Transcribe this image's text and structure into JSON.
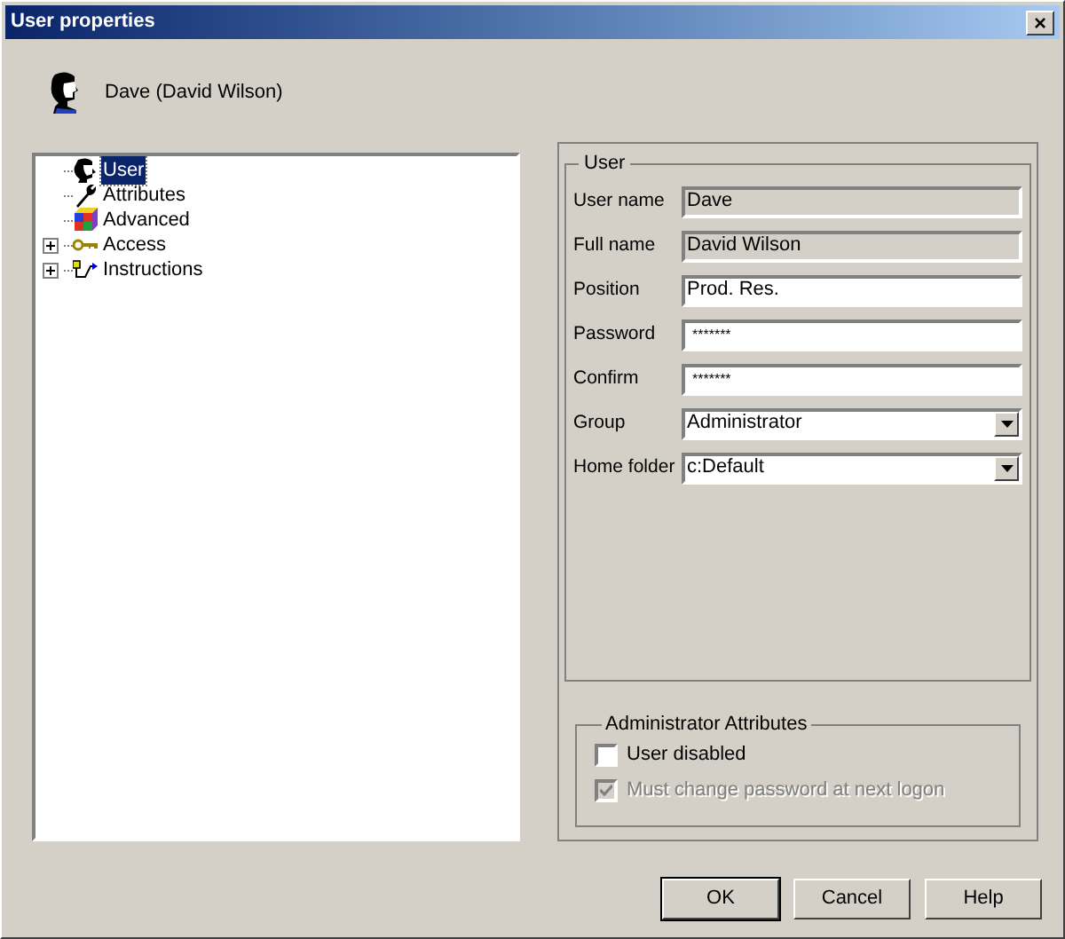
{
  "window": {
    "title": "User properties",
    "close": "×"
  },
  "header": {
    "title": "Dave (David Wilson)"
  },
  "tree": {
    "items": [
      {
        "label": "User",
        "kind": "leaf",
        "selected": true
      },
      {
        "label": "Attributes",
        "kind": "leaf",
        "selected": false
      },
      {
        "label": "Advanced",
        "kind": "leaf",
        "selected": false
      },
      {
        "label": "Access",
        "kind": "folder",
        "selected": false
      },
      {
        "label": "Instructions",
        "kind": "folder",
        "selected": false
      }
    ]
  },
  "user_group": {
    "title": "User",
    "fields": [
      {
        "label": "User name",
        "value": "Dave",
        "kind": "readonly"
      },
      {
        "label": "Full name",
        "value": "David Wilson",
        "kind": "readonly"
      },
      {
        "label": "Position",
        "value": "Prod. Res.",
        "kind": "text"
      },
      {
        "label": "Password",
        "value": "*******",
        "kind": "password"
      },
      {
        "label": "Confirm",
        "value": "*******",
        "kind": "password"
      },
      {
        "label": "Group",
        "value": "Administrator",
        "kind": "select"
      },
      {
        "label": "Home folder",
        "value": "c:Default",
        "kind": "select"
      }
    ]
  },
  "admin_group": {
    "title": "Administrator Attributes",
    "options": [
      {
        "label": "User disabled",
        "checked": false,
        "disabled": false
      },
      {
        "label": "Must change password at next logon",
        "checked": true,
        "disabled": true
      }
    ]
  },
  "buttons": [
    {
      "label": "OK",
      "default": true
    },
    {
      "label": "Cancel",
      "default": false
    },
    {
      "label": "Help",
      "default": false
    }
  ]
}
